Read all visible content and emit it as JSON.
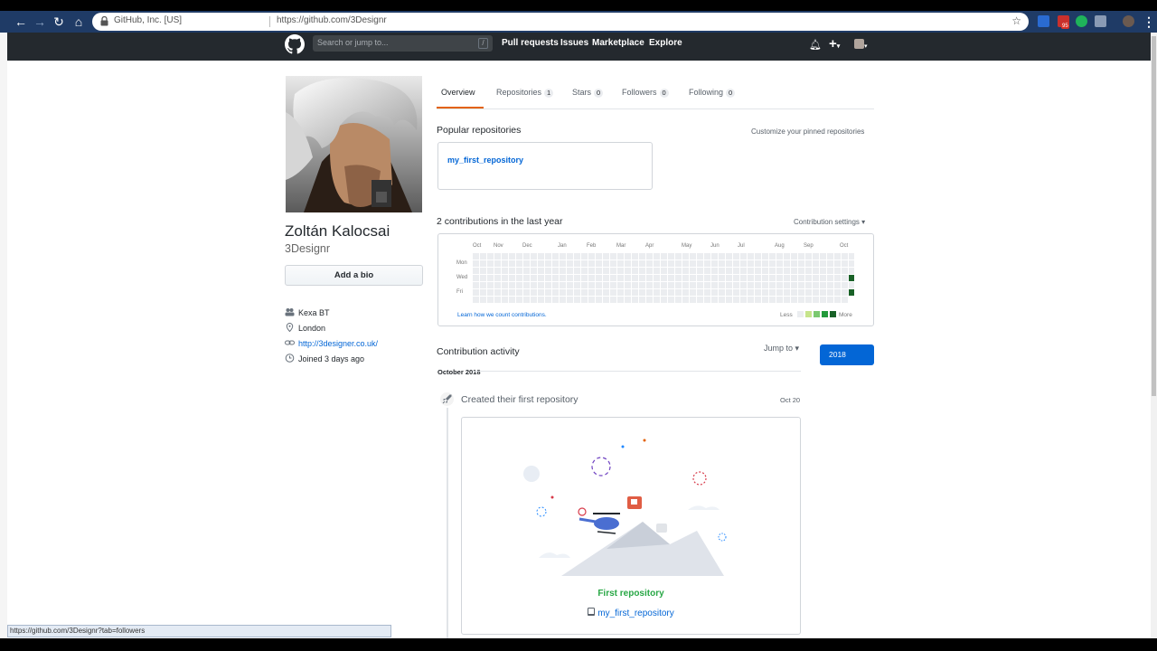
{
  "browser": {
    "site_label": "GitHub, Inc. [US]",
    "url": "https://github.com/3Designr",
    "ext_badge": "95",
    "status_url": "https://github.com/3Designr?tab=followers"
  },
  "header": {
    "search_placeholder": "Search or jump to...",
    "search_shortcut": "/",
    "nav": [
      "Pull requests",
      "Issues",
      "Marketplace",
      "Explore"
    ],
    "plus": "+"
  },
  "profile": {
    "fullname": "Zoltán Kalocsai",
    "username": "3Designr",
    "bio_button": "Add a bio",
    "company": "Kexa BT",
    "location": "London",
    "website": "http://3designer.co.uk/",
    "joined": "Joined 3 days ago"
  },
  "tabs": [
    {
      "label": "Overview",
      "count": ""
    },
    {
      "label": "Repositories",
      "count": "1"
    },
    {
      "label": "Stars",
      "count": "0"
    },
    {
      "label": "Followers",
      "count": "0"
    },
    {
      "label": "Following",
      "count": "0"
    }
  ],
  "popular": {
    "title": "Popular repositories",
    "customize": "Customize your pinned repositories",
    "repo": "my_first_repository"
  },
  "contributions": {
    "title": "2 contributions in the last year",
    "settings": "Contribution settings",
    "months": [
      "Oct",
      "Nov",
      "Dec",
      "Jan",
      "Feb",
      "Mar",
      "Apr",
      "May",
      "Jun",
      "Jul",
      "Aug",
      "Sep",
      "Oct"
    ],
    "weekdays": [
      "Mon",
      "Wed",
      "Fri"
    ],
    "learn": "Learn how we count contributions.",
    "less": "Less",
    "more": "More",
    "colors": [
      "#ebedf0",
      "#c6e48b",
      "#7bc96f",
      "#239a3b",
      "#196127"
    ],
    "weeks": 53
  },
  "activity": {
    "title": "Contribution activity",
    "jump": "Jump to",
    "year": "2018",
    "month": "October 2018",
    "event": "Created their first repository",
    "date": "Oct 20",
    "card_title": "First repository",
    "card_repo": "my_first_repository"
  }
}
